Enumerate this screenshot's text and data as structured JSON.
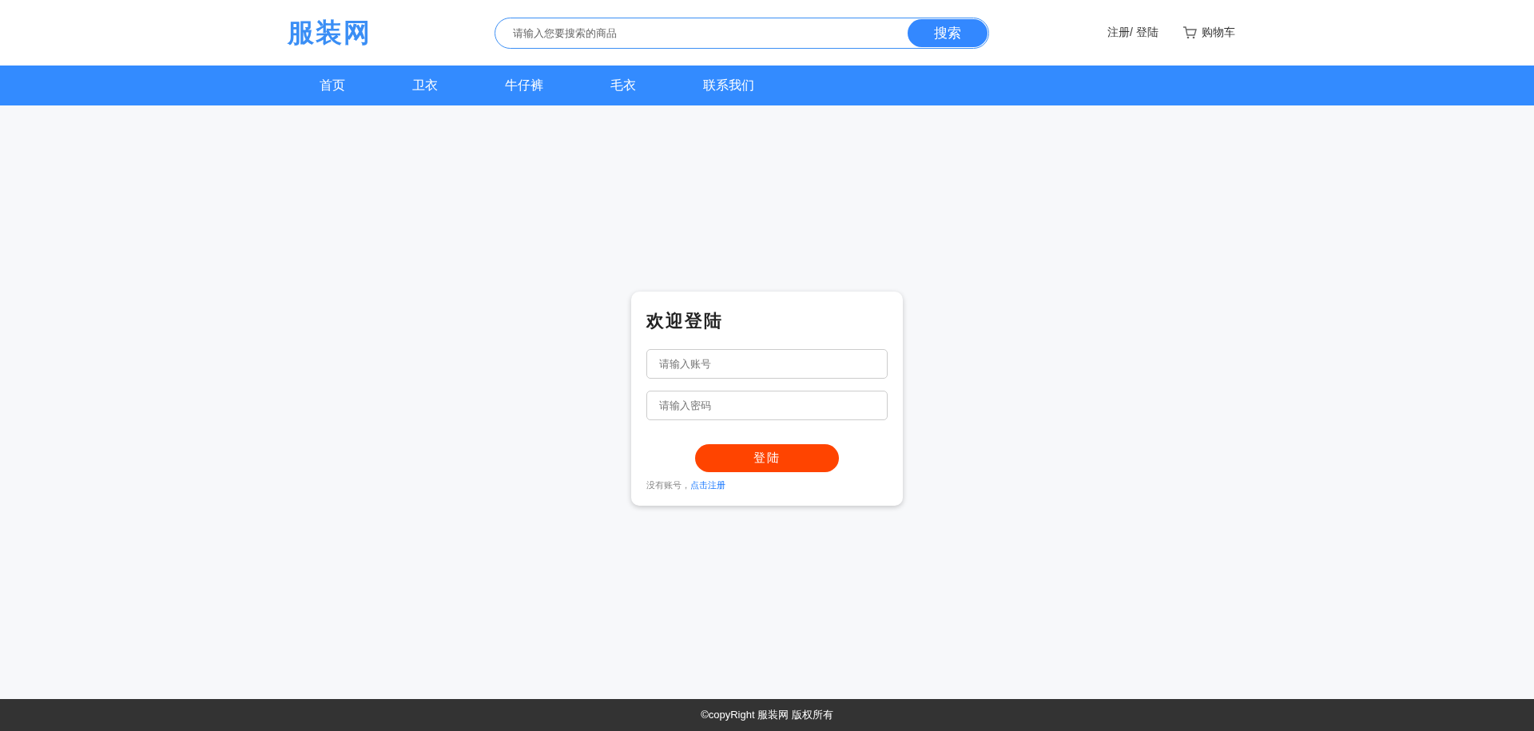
{
  "header": {
    "logo": "服装网",
    "search": {
      "placeholder": "请输入您要搜索的商品",
      "button": "搜索"
    },
    "account_link": "注册/ 登陆",
    "cart_link": "购物车"
  },
  "nav": [
    "首页",
    "卫衣",
    "牛仔裤",
    "毛衣",
    "联系我们"
  ],
  "login_card": {
    "title": "欢迎登陆",
    "account_field": {
      "placeholder": "请输入账号"
    },
    "password_field": {
      "placeholder": "请输入密码"
    },
    "button": "登陆",
    "register_prompt": "没有账号，",
    "register_link": "点击注册"
  },
  "footer": "©copyRight 服装网 版权所有"
}
